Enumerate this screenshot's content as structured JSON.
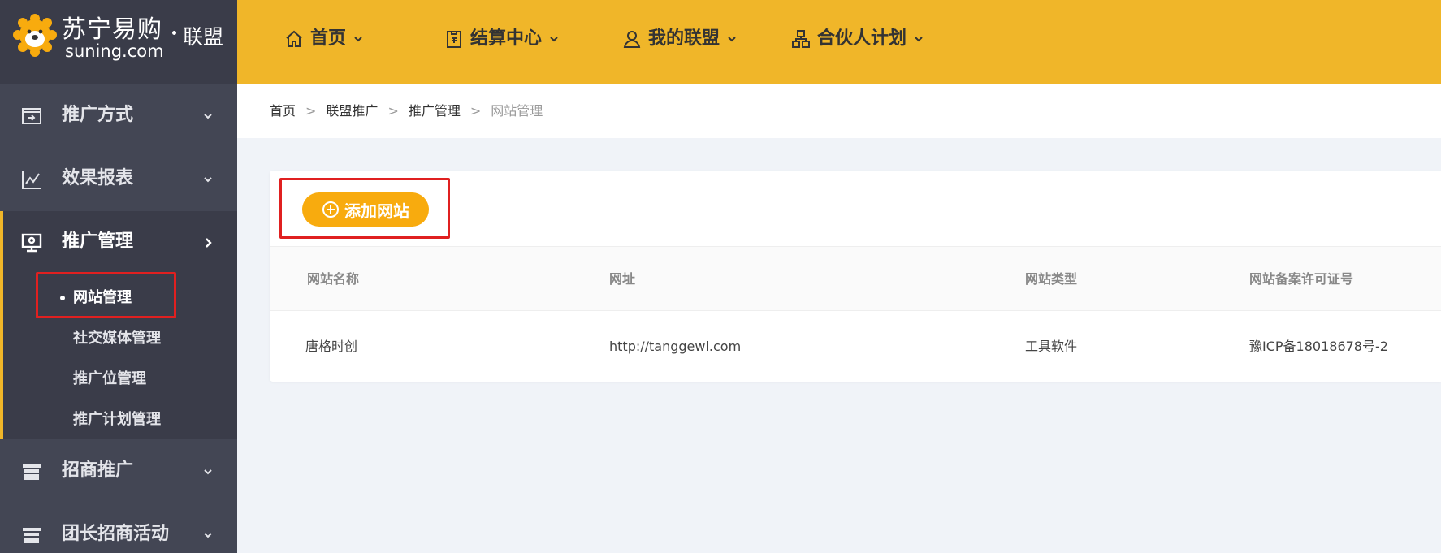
{
  "logo": {
    "brand_cn": "苏宁易购",
    "brand_en": "suning.com",
    "sub": "联盟"
  },
  "sidebar": {
    "items": [
      {
        "label": "推广方式",
        "icon": "promotion-icon"
      },
      {
        "label": "效果报表",
        "icon": "chart-icon"
      },
      {
        "label": "推广管理",
        "icon": "monitor-icon"
      },
      {
        "label": "招商推广",
        "icon": "store-icon"
      },
      {
        "label": "团长招商活动",
        "icon": "store-icon"
      }
    ],
    "sub_items": [
      "网站管理",
      "社交媒体管理",
      "推广位管理",
      "推广计划管理"
    ],
    "active_sub": "网站管理"
  },
  "topnav": {
    "items": [
      {
        "label": "首页",
        "icon": "home-icon"
      },
      {
        "label": "结算中心",
        "icon": "clipboard-icon"
      },
      {
        "label": "我的联盟",
        "icon": "user-icon"
      },
      {
        "label": "合伙人计划",
        "icon": "org-icon"
      }
    ]
  },
  "breadcrumb": {
    "items": [
      "首页",
      "联盟推广",
      "推广管理",
      "网站管理"
    ],
    "separator": ">"
  },
  "main": {
    "add_button": "添加网站",
    "columns": [
      "网站名称",
      "网址",
      "网站类型",
      "网站备案许可证号"
    ],
    "rows": [
      [
        "唐格时创",
        "http://tanggewl.com",
        "工具软件",
        "豫ICP备18018678号-2"
      ]
    ]
  },
  "colors": {
    "accent": "#f0b629",
    "sidebar": "#434654",
    "button": "#f8ab0e",
    "highlight": "#e02020"
  }
}
